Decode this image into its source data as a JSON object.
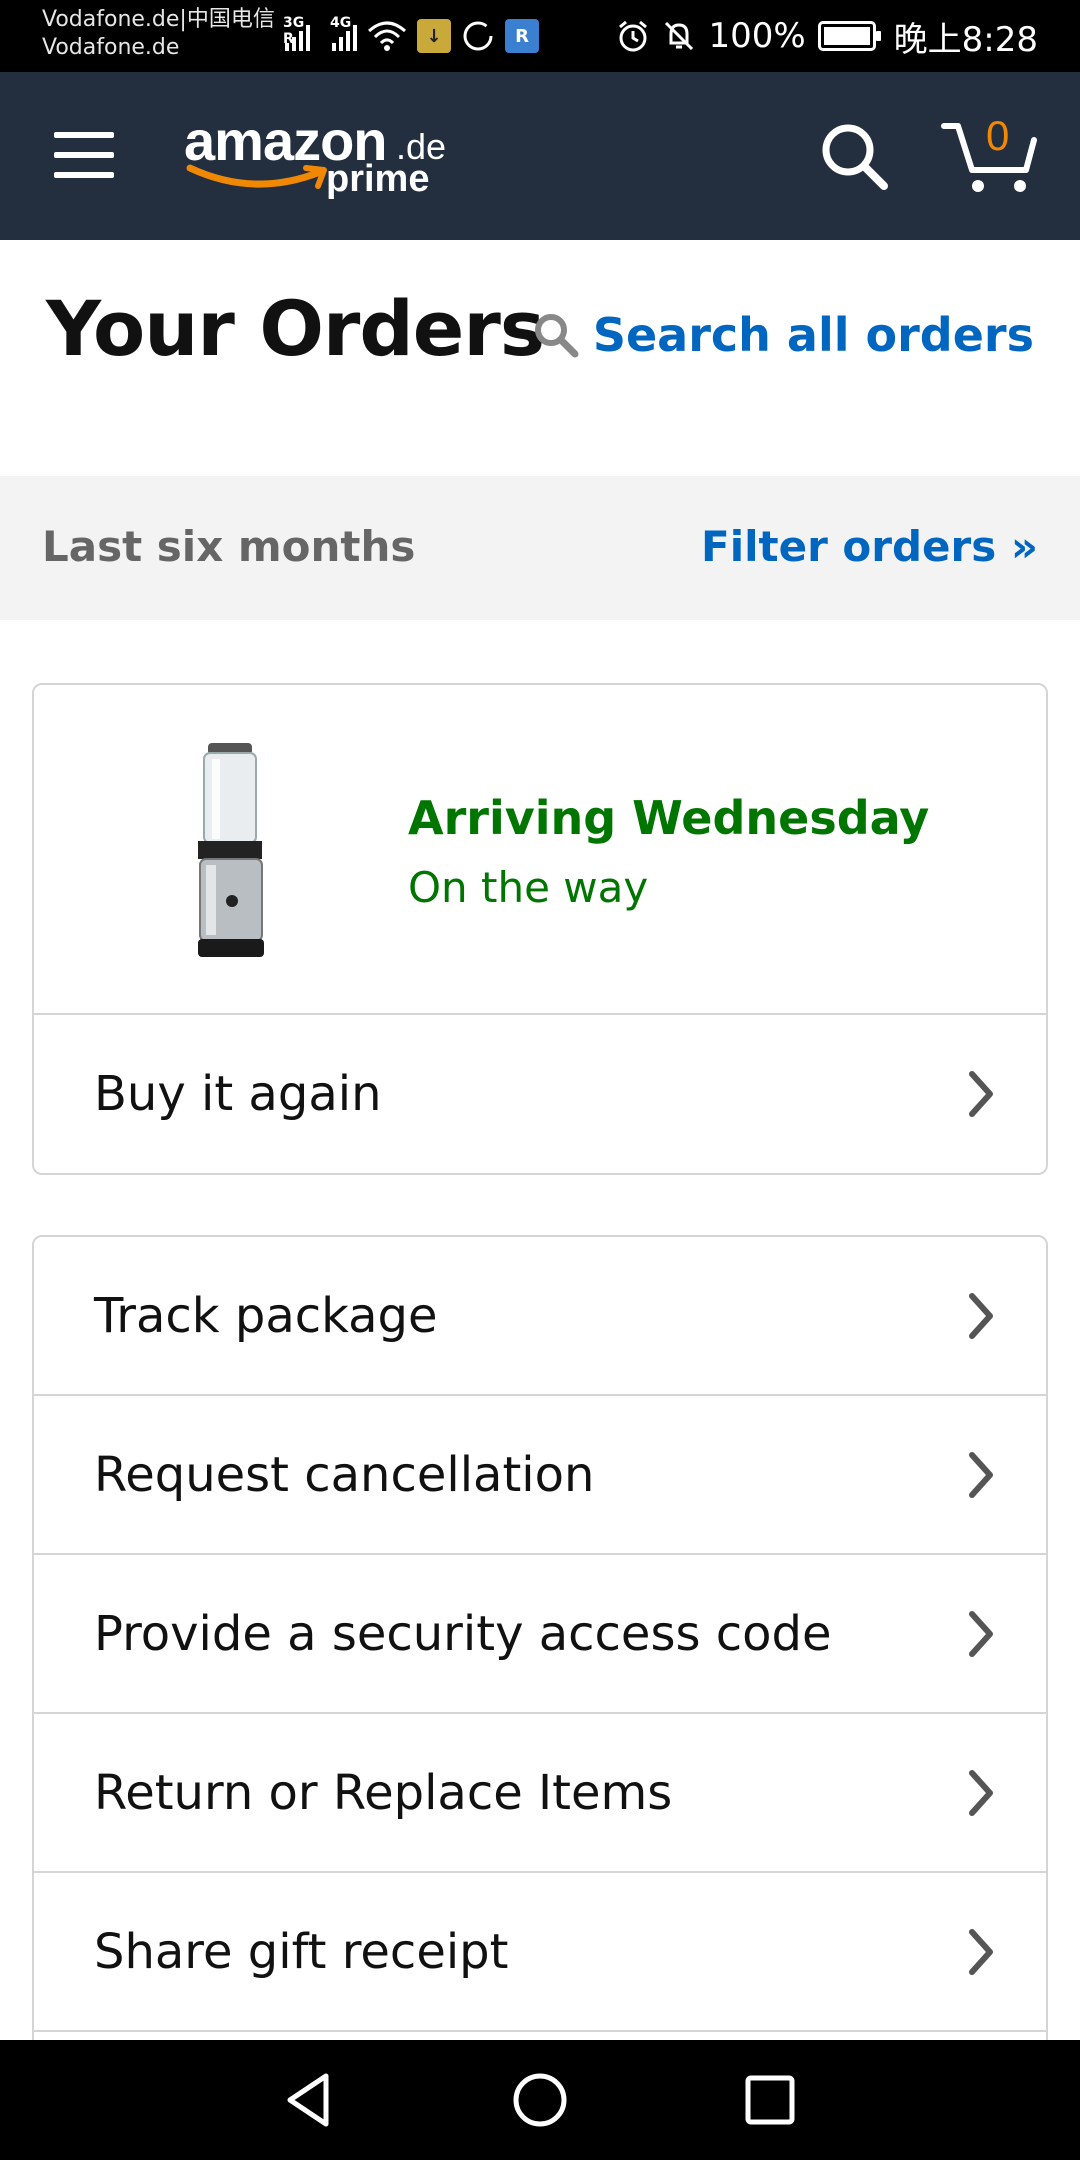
{
  "status_bar": {
    "carrier_line1": "Vodafone.de|中国电信",
    "carrier_line2": "Vodafone.de",
    "net_3g": "3G R",
    "net_4g": "4G",
    "battery": "100%",
    "time": "晚上8:28"
  },
  "header": {
    "logo_text": "amazon",
    "logo_tld": ".de",
    "logo_sub": "prime",
    "cart_count": "0",
    "colors": {
      "bg": "#232f3e",
      "accent": "#f08804"
    }
  },
  "page": {
    "title": "Your Orders",
    "search_label": "Search all orders"
  },
  "filter": {
    "range": "Last six months",
    "link": "Filter orders »"
  },
  "order": {
    "delivery_title": "Arriving Wednesday",
    "delivery_status": "On the way",
    "status_color": "#007600",
    "product_icon": "blender-product-image",
    "buy_again": "Buy it again"
  },
  "actions": [
    {
      "label": "Track package"
    },
    {
      "label": "Request cancellation"
    },
    {
      "label": "Provide a security access code"
    },
    {
      "label": "Return or Replace Items"
    },
    {
      "label": "Share gift receipt"
    }
  ],
  "nav": {
    "icons": [
      "back-icon",
      "home-icon",
      "recents-icon"
    ]
  }
}
